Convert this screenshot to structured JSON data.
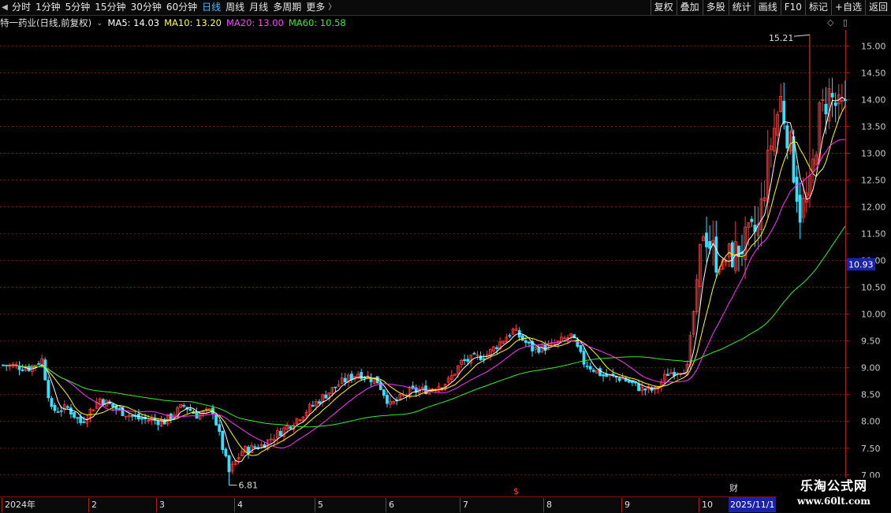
{
  "toolbar": {
    "nav_prev": "◀",
    "periods": [
      "分时",
      "1分钟",
      "5分钟",
      "15分钟",
      "30分钟",
      "60分钟",
      "日线",
      "周线",
      "月线",
      "多周期",
      "更多"
    ],
    "active_period": "日线",
    "more_arrow": "〉",
    "right_buttons": [
      "复权",
      "叠加",
      "多股",
      "统计",
      "画线",
      "F10",
      "标记",
      "+自选",
      "返回"
    ]
  },
  "info": {
    "title": "特一药业(日线,前复权)",
    "ma5": "MA5: 14.03",
    "ma10": "MA10: 13.20",
    "ma20": "MA20: 13.00",
    "ma60": "MA60: 10.58",
    "colors": {
      "ma5": "#ffffff",
      "ma10": "#ffff00",
      "ma20": "#ff33ff",
      "ma60": "#33ee33"
    }
  },
  "corner": {
    "diamond_icon": "◇",
    "panel_icon": "▯"
  },
  "watermark": {
    "line1": "乐淘公式网",
    "line2": "www.60lt.com"
  },
  "chart_data": {
    "type": "candlestick",
    "ylim": [
      6.6,
      15.3
    ],
    "y_ticks": [
      "15.00",
      "14.50",
      "14.00",
      "13.50",
      "13.00",
      "12.50",
      "12.00",
      "11.50",
      "11.00",
      "10.50",
      "10.00",
      "9.50",
      "9.00",
      "8.50",
      "8.00",
      "7.50",
      "7.00"
    ],
    "current_price": "10.93",
    "high_label": "15.21",
    "low_label": "6.81",
    "x_labels": [
      "2024年",
      "2",
      "3",
      "4",
      "5",
      "6",
      "7",
      "8",
      "9",
      "10"
    ],
    "cursor_date": "2025/11/1",
    "fin_marker": "财",
    "s_marker": "$",
    "up_color": "#ff3b3b",
    "down_color": "#33e0ff",
    "anchors": [
      [
        0,
        9.05
      ],
      [
        8,
        9.0
      ],
      [
        12,
        9.15
      ],
      [
        15,
        8.2
      ],
      [
        20,
        8.25
      ],
      [
        24,
        7.98
      ],
      [
        30,
        8.42
      ],
      [
        36,
        8.2
      ],
      [
        42,
        8.05
      ],
      [
        50,
        8.0
      ],
      [
        56,
        8.3
      ],
      [
        60,
        8.12
      ],
      [
        65,
        8.2
      ],
      [
        70,
        7.05
      ],
      [
        74,
        7.45
      ],
      [
        80,
        7.55
      ],
      [
        88,
        7.9
      ],
      [
        96,
        8.3
      ],
      [
        104,
        8.7
      ],
      [
        110,
        8.9
      ],
      [
        116,
        8.75
      ],
      [
        120,
        8.3
      ],
      [
        126,
        8.55
      ],
      [
        132,
        8.6
      ],
      [
        138,
        8.75
      ],
      [
        142,
        9.1
      ],
      [
        150,
        9.25
      ],
      [
        158,
        9.7
      ],
      [
        164,
        9.35
      ],
      [
        170,
        9.4
      ],
      [
        176,
        9.6
      ],
      [
        180,
        9.1
      ],
      [
        186,
        8.85
      ],
      [
        192,
        8.8
      ],
      [
        198,
        8.6
      ],
      [
        202,
        8.58
      ],
      [
        206,
        8.9
      ],
      [
        212,
        9.0
      ],
      [
        217,
        11.6
      ],
      [
        222,
        10.9
      ],
      [
        228,
        11.2
      ],
      [
        234,
        11.6
      ],
      [
        238,
        13.2
      ],
      [
        241,
        14.0
      ],
      [
        244,
        13.1
      ],
      [
        247,
        11.9
      ],
      [
        250,
        12.3
      ],
      [
        253,
        13.7
      ],
      [
        256,
        14.1
      ],
      [
        259,
        13.8
      ]
    ],
    "high_mark": [
      250,
      15.21
    ],
    "low_mark": [
      70,
      6.81
    ],
    "x_label_positions": [
      0,
      27,
      48,
      72,
      97,
      119,
      142,
      168,
      192,
      216
    ]
  }
}
